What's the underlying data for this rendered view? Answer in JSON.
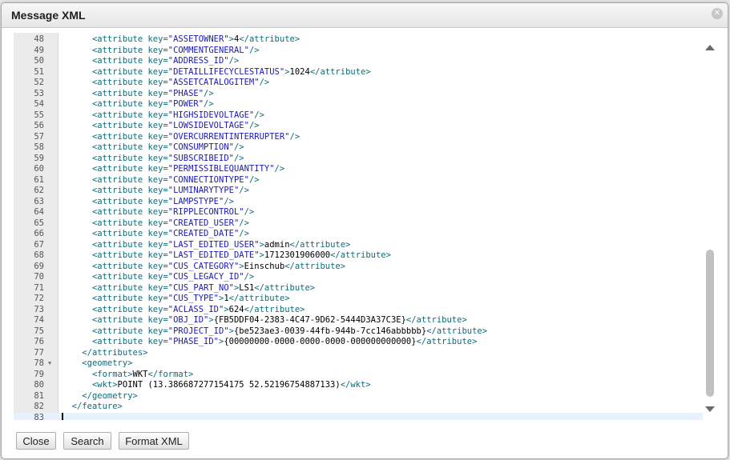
{
  "dialog": {
    "title": "Message XML"
  },
  "editor": {
    "lines": [
      {
        "n": "48",
        "indent": "      ",
        "key": "ASSETOWNER",
        "value": "4"
      },
      {
        "n": "49",
        "indent": "      ",
        "key": "COMMENTGENERAL",
        "value": null
      },
      {
        "n": "50",
        "indent": "      ",
        "key": "ADDRESS_ID",
        "value": null
      },
      {
        "n": "51",
        "indent": "      ",
        "key": "DETAILLIFECYCLESTATUS",
        "value": "1024"
      },
      {
        "n": "52",
        "indent": "      ",
        "key": "ASSETCATALOGITEM",
        "value": null
      },
      {
        "n": "53",
        "indent": "      ",
        "key": "PHASE",
        "value": null
      },
      {
        "n": "54",
        "indent": "      ",
        "key": "POWER",
        "value": null
      },
      {
        "n": "55",
        "indent": "      ",
        "key": "HIGHSIDEVOLTAGE",
        "value": null
      },
      {
        "n": "56",
        "indent": "      ",
        "key": "LOWSIDEVOLTAGE",
        "value": null
      },
      {
        "n": "57",
        "indent": "      ",
        "key": "OVERCURRENTINTERRUPTER",
        "value": null
      },
      {
        "n": "58",
        "indent": "      ",
        "key": "CONSUMPTION",
        "value": null
      },
      {
        "n": "59",
        "indent": "      ",
        "key": "SUBSCRIBEID",
        "value": null
      },
      {
        "n": "60",
        "indent": "      ",
        "key": "PERMISSIBLEQUANTITY",
        "value": null
      },
      {
        "n": "61",
        "indent": "      ",
        "key": "CONNECTIONTYPE",
        "value": null
      },
      {
        "n": "62",
        "indent": "      ",
        "key": "LUMINARYTYPE",
        "value": null
      },
      {
        "n": "63",
        "indent": "      ",
        "key": "LAMPSTYPE",
        "value": null
      },
      {
        "n": "64",
        "indent": "      ",
        "key": "RIPPLECONTROL",
        "value": null
      },
      {
        "n": "65",
        "indent": "      ",
        "key": "CREATED_USER",
        "value": null
      },
      {
        "n": "66",
        "indent": "      ",
        "key": "CREATED_DATE",
        "value": null
      },
      {
        "n": "67",
        "indent": "      ",
        "key": "LAST_EDITED_USER",
        "value": "admin"
      },
      {
        "n": "68",
        "indent": "      ",
        "key": "LAST_EDITED_DATE",
        "value": "1712301906000"
      },
      {
        "n": "69",
        "indent": "      ",
        "key": "CUS_CATEGORY",
        "value": "Einschub"
      },
      {
        "n": "70",
        "indent": "      ",
        "key": "CUS_LEGACY_ID",
        "value": null
      },
      {
        "n": "71",
        "indent": "      ",
        "key": "CUS_PART_NO",
        "value": "LS1"
      },
      {
        "n": "72",
        "indent": "      ",
        "key": "CUS_TYPE",
        "value": "1"
      },
      {
        "n": "73",
        "indent": "      ",
        "key": "ACLASS_ID",
        "value": "624"
      },
      {
        "n": "74",
        "indent": "      ",
        "key": "OBJ_ID",
        "value": "{FB5DDF04-2383-4C47-9D62-5444D3A37C3E}"
      },
      {
        "n": "75",
        "indent": "      ",
        "key": "PROJECT_ID",
        "value": "{be523ae3-0039-44fb-944b-7cc146abbbbb}"
      },
      {
        "n": "76",
        "indent": "      ",
        "key": "PHASE_ID",
        "value": "{00000000-0000-0000-0000-000000000000}"
      },
      {
        "n": "77",
        "indent": "    ",
        "raw": [
          [
            "tag",
            "</attributes>"
          ]
        ]
      },
      {
        "n": "78",
        "indent": "    ",
        "fold": "▼",
        "raw": [
          [
            "tag",
            "<geometry>"
          ]
        ]
      },
      {
        "n": "79",
        "indent": "      ",
        "raw": [
          [
            "tag",
            "<format>"
          ],
          [
            "txt",
            "WKT"
          ],
          [
            "tag",
            "</format>"
          ]
        ]
      },
      {
        "n": "80",
        "indent": "      ",
        "raw": [
          [
            "tag",
            "<wkt>"
          ],
          [
            "txt",
            "POINT (13.386687277154175 52.52196754887133)"
          ],
          [
            "tag",
            "</wkt>"
          ]
        ]
      },
      {
        "n": "81",
        "indent": "    ",
        "raw": [
          [
            "tag",
            "</geometry>"
          ]
        ]
      },
      {
        "n": "82",
        "indent": "  ",
        "raw": [
          [
            "tag",
            "</feature>"
          ]
        ]
      },
      {
        "n": "83",
        "indent": "",
        "raw": [],
        "active": true
      }
    ]
  },
  "buttons": {
    "close": "Close",
    "search": "Search",
    "format": "Format XML"
  },
  "icons": {
    "close": "close-circle-icon",
    "scroll_up": "triangle-up-icon",
    "scroll_down": "triangle-down-icon"
  },
  "colors": {
    "tag": "#0e6b78",
    "string": "#1a1ab4",
    "gutter": "#ebebeb",
    "active_line": "#e8f2fe"
  }
}
